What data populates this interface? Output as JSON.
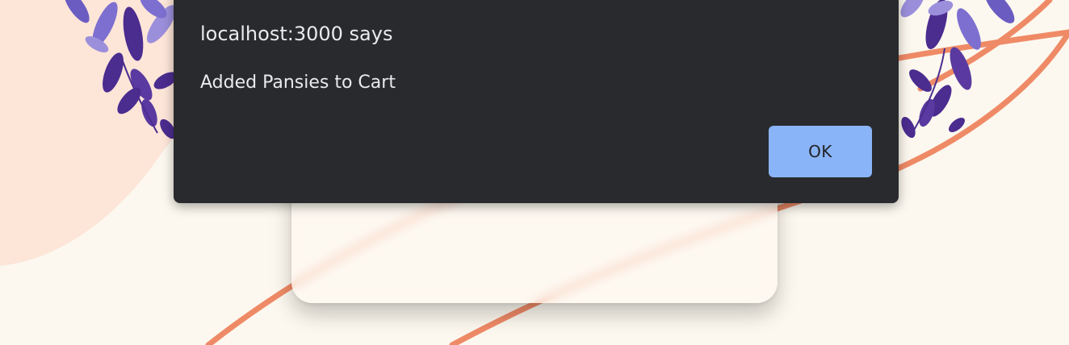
{
  "dialog": {
    "title": "localhost:3000 says",
    "message": "Added Pansies to Cart",
    "ok_label": "OK"
  },
  "colors": {
    "page_background": "#fcf8ef",
    "peach_shape": "#fde5d8",
    "orange_line": "#ef8a66",
    "wisteria_dark": "#4b2c8f",
    "wisteria_mid": "#6b5cc2",
    "wisteria_light": "#9b8fdb",
    "dialog_background": "#292a2d",
    "dialog_text": "#e8eaed",
    "button_background": "#8ab4f8",
    "button_text": "#202124"
  },
  "background": {
    "decoration": "wisteria-flowers"
  }
}
